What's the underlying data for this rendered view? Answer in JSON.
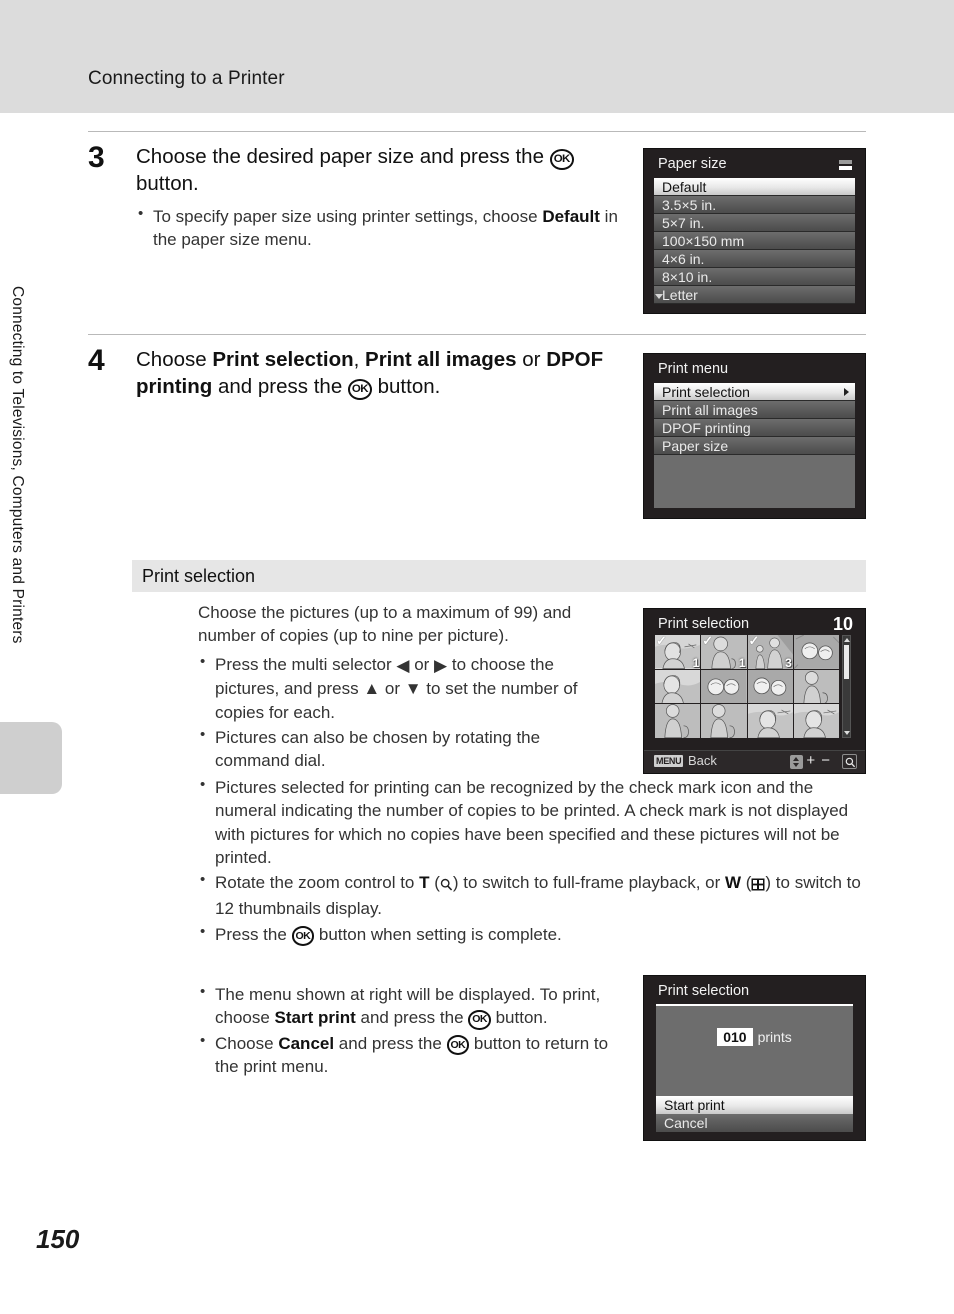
{
  "header": {
    "title": "Connecting to a Printer"
  },
  "sidebar": {
    "chapter": "Connecting to Televisions, Computers and Printers"
  },
  "footer": {
    "page_number": "150"
  },
  "steps": [
    {
      "number": "3",
      "lead_part1": "Choose the desired paper size and press the ",
      "lead_ok": "OK",
      "lead_part2": " button.",
      "bullets": [
        {
          "t1": "To specify paper size using printer settings, choose ",
          "b1": "Default",
          "t2": " in the paper size menu."
        }
      ]
    },
    {
      "number": "4",
      "lead_part1": "Choose ",
      "lead_b1": "Print selection",
      "lead_mid1": ", ",
      "lead_b2": "Print all images",
      "lead_mid2": " or ",
      "lead_b3": "DPOF printing",
      "lead_mid3": " and press the ",
      "lead_ok": "OK",
      "lead_part2": " button."
    }
  ],
  "section": {
    "title": "Print selection",
    "intro": "Choose the pictures (up to a maximum of 99) and number of copies (up to nine per picture).",
    "bullets": [
      {
        "id": "multi-selector",
        "t1": "Press the multi selector ",
        "g1": "◀",
        "t2": " or ",
        "g2": "▶",
        "t3": " to choose the pictures, and press ",
        "g3": "▲",
        "t4": " or ",
        "g4": "▼",
        "t5": " to set the number of copies for each."
      },
      {
        "id": "command-dial",
        "t1": "Pictures can also be chosen by rotating the command dial."
      },
      {
        "id": "check-mark",
        "t1": "Pictures selected for printing can be recognized by the check mark icon and the numeral indicating the number of copies to be printed. A check mark is not displayed with pictures for which no copies have been specified and these pictures will not be printed."
      },
      {
        "id": "zoom-control",
        "t1": "Rotate the zoom control to ",
        "g1": "T",
        "t2": " (",
        "g2": "magnifier-icon",
        "t3": ") to switch to full-frame playback, or ",
        "g3": "W",
        "t4": " (",
        "g4": "thumbnails-icon",
        "t5": ") to switch to 12 thumbnails display."
      },
      {
        "id": "press-ok",
        "t1": "Press the ",
        "g1": "OK",
        "t2": " button when setting is complete."
      }
    ],
    "bullets2": [
      {
        "id": "menu-at-right",
        "t1": "The menu shown at right will be displayed. To print, choose ",
        "b1": "Start print",
        "t2": " and press the ",
        "g1": "OK",
        "t3": " button."
      },
      {
        "id": "cancel",
        "t1": "Choose ",
        "b1": "Cancel",
        "t2": " and press the ",
        "g1": "OK",
        "t3": " button to return to the print menu."
      }
    ]
  },
  "screens": {
    "paper_size": {
      "title": "Paper size",
      "icon": "two-bar-icon",
      "items": [
        {
          "label": "Default",
          "selected": true
        },
        {
          "label": "3.5×5 in.",
          "selected": false
        },
        {
          "label": "5×7 in.",
          "selected": false
        },
        {
          "label": "100×150 mm",
          "selected": false
        },
        {
          "label": "4×6 in.",
          "selected": false
        },
        {
          "label": "8×10 in.",
          "selected": false
        },
        {
          "label": "Letter",
          "selected": false,
          "more": true
        }
      ]
    },
    "print_menu": {
      "title": "Print menu",
      "items": [
        {
          "label": "Print selection",
          "selected": true,
          "arrow": true
        },
        {
          "label": "Print all images",
          "selected": false
        },
        {
          "label": "DPOF printing",
          "selected": false
        },
        {
          "label": "Paper size",
          "selected": false
        }
      ]
    },
    "print_selection": {
      "title": "Print selection",
      "count": "10",
      "thumbnails": [
        {
          "checked": true,
          "copies": "1",
          "current": true,
          "art": "portrait"
        },
        {
          "checked": true,
          "copies": "1",
          "current": false,
          "art": "person"
        },
        {
          "checked": true,
          "copies": "3",
          "current": false,
          "art": "two-people"
        },
        {
          "checked": false,
          "copies": "",
          "current": false,
          "art": "flowers"
        },
        {
          "checked": false,
          "copies": "",
          "current": false,
          "art": "portrait"
        },
        {
          "checked": false,
          "copies": "",
          "current": false,
          "art": "flowers"
        },
        {
          "checked": false,
          "copies": "",
          "current": false,
          "art": "flowers"
        },
        {
          "checked": false,
          "copies": "",
          "current": false,
          "art": "person"
        },
        {
          "checked": false,
          "copies": "",
          "current": false,
          "art": "person"
        },
        {
          "checked": false,
          "copies": "",
          "current": false,
          "art": "person"
        },
        {
          "checked": false,
          "copies": "",
          "current": false,
          "art": "portrait"
        },
        {
          "checked": false,
          "copies": "",
          "current": false,
          "art": "portrait"
        }
      ],
      "bottom": {
        "menu_chip": "MENU",
        "back_label": "Back",
        "updown_icon": "up-down-arrows-icon",
        "plus_minus": "+ −",
        "magnifier_icon": "magnifier-icon"
      }
    },
    "confirm": {
      "title": "Print selection",
      "count_value": "010",
      "count_unit": "prints",
      "items": [
        {
          "label": "Start print",
          "selected": true
        },
        {
          "label": "Cancel",
          "selected": false
        }
      ]
    }
  }
}
